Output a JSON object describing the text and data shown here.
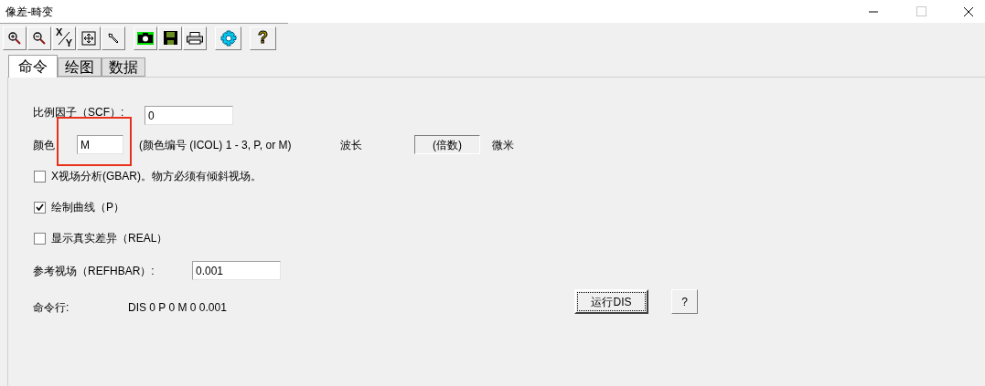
{
  "window": {
    "title": "像差-畸变"
  },
  "toolbar": [
    {
      "kind": "zoom-in"
    },
    {
      "kind": "zoom-out"
    },
    {
      "kind": "axes",
      "top": "X",
      "bottom": "Y"
    },
    {
      "kind": "fit"
    },
    {
      "kind": "pointer"
    },
    {
      "kind": "camera"
    },
    {
      "kind": "save"
    },
    {
      "kind": "print"
    },
    {
      "kind": "settings"
    },
    {
      "kind": "help",
      "label": "?"
    }
  ],
  "tabs": [
    {
      "label": "命令",
      "selected": true
    },
    {
      "label": "绘图",
      "selected": false
    },
    {
      "label": "数据",
      "selected": false
    }
  ],
  "scf": {
    "label": "比例因子（SCF）:",
    "value": "0"
  },
  "color": {
    "label": "颜色",
    "value": "M",
    "hint": "(颜色编号 (ICOL) 1 - 3, P, or M)",
    "highlighted": true
  },
  "wavelength": {
    "label": "波长",
    "value": "(倍数)",
    "unit": "微米"
  },
  "checkboxes": [
    {
      "label": "X视场分析(GBAR)。物方必须有倾斜视场。",
      "checked": false
    },
    {
      "label": "绘制曲线（P）",
      "checked": true
    },
    {
      "label": "显示真实差异（REAL）",
      "checked": false
    }
  ],
  "refhbar": {
    "label": "参考视场（REFHBAR）:",
    "value": "0.001"
  },
  "command": {
    "label": "命令行:",
    "value": "DIS 0 P 0 M 0 0.001"
  },
  "buttons": [
    {
      "label": "运行DIS",
      "focused": true
    },
    {
      "label": "?",
      "focused": false
    }
  ]
}
